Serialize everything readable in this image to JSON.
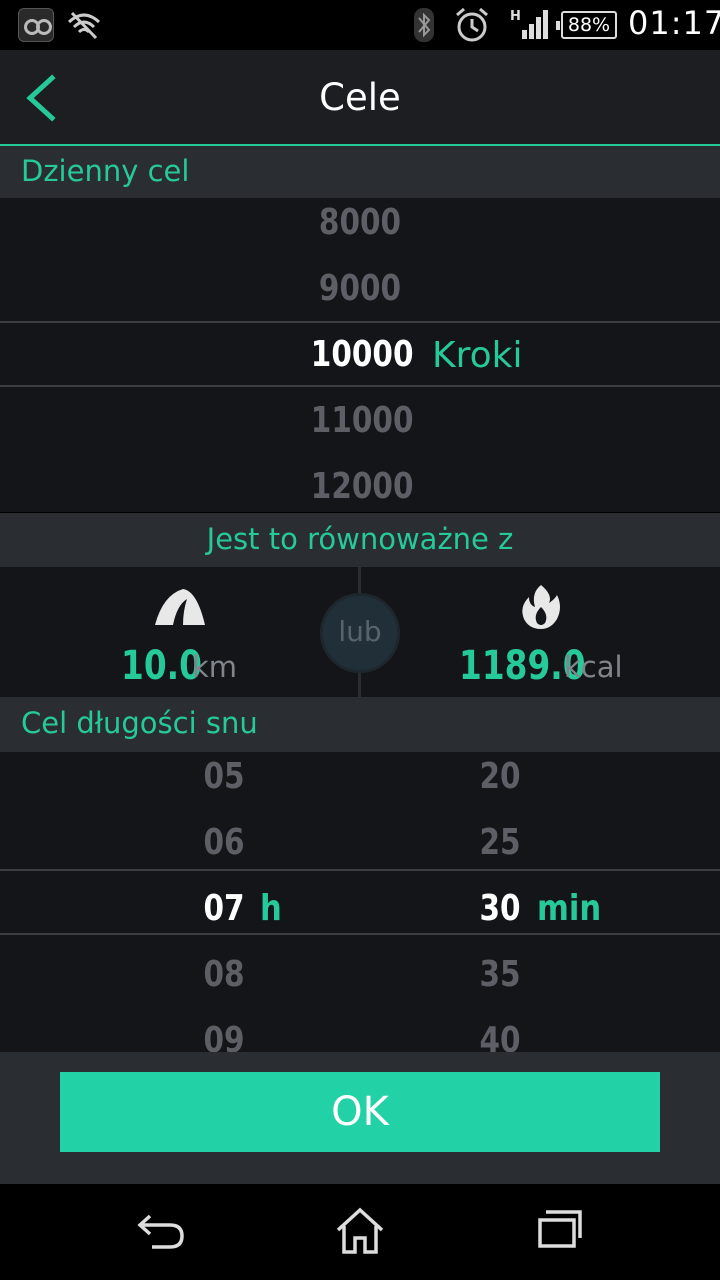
{
  "status_bar": {
    "battery": "88%",
    "time": "01:17",
    "network_type": "H"
  },
  "header": {
    "title": "Cele"
  },
  "daily_goal": {
    "section_title": "Dzienny cel",
    "values": [
      "8000",
      "9000",
      "10000",
      "11000",
      "12000"
    ],
    "selected_unit": "Kroki"
  },
  "equivalent": {
    "section_title": "Jest to równoważne z",
    "distance_value": "10.0",
    "distance_unit": "km",
    "or_label": "lub",
    "calories_value": "1189.0",
    "calories_unit": "kcal"
  },
  "sleep_goal": {
    "section_title": "Cel długości snu",
    "hours": [
      "05",
      "06",
      "07",
      "08",
      "09"
    ],
    "hours_unit": "h",
    "minutes": [
      "20",
      "25",
      "30",
      "35",
      "40"
    ],
    "minutes_unit": "min"
  },
  "ok_button": {
    "label": "OK"
  },
  "colors": {
    "accent": "#26c99a",
    "button": "#22d1a6"
  }
}
